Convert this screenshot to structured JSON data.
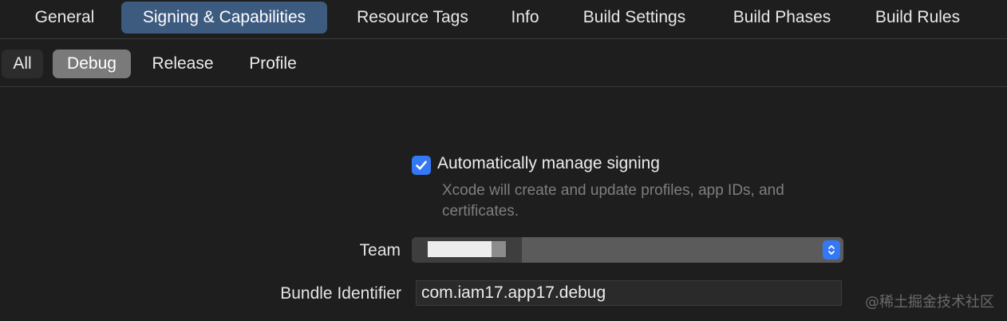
{
  "top_tabs": [
    {
      "label": "General"
    },
    {
      "label": "Signing & Capabilities",
      "selected": true
    },
    {
      "label": "Resource Tags"
    },
    {
      "label": "Info"
    },
    {
      "label": "Build Settings"
    },
    {
      "label": "Build Phases"
    },
    {
      "label": "Build Rules"
    }
  ],
  "config_tabs": [
    {
      "label": "All"
    },
    {
      "label": "Debug",
      "selected": true
    },
    {
      "label": "Release"
    },
    {
      "label": "Profile"
    }
  ],
  "signing": {
    "auto_manage_label": "Automatically manage signing",
    "auto_manage_checked": true,
    "auto_manage_description": "Xcode will create and update profiles, app IDs, and certificates.",
    "team_label": "Team",
    "team_value_redacted": true,
    "bundle_label": "Bundle Identifier",
    "bundle_value": "com.iam17.app17.debug"
  },
  "watermark": "@稀土掘金技术社区",
  "colors": {
    "accent": "#3478f6",
    "selected_tab": "#3d5b7f",
    "selected_config": "#7a7a7a",
    "background": "#1e1e1e"
  },
  "icons": {
    "checkbox": "checkmark-icon",
    "team_popup": "chevron-up-down-icon"
  }
}
